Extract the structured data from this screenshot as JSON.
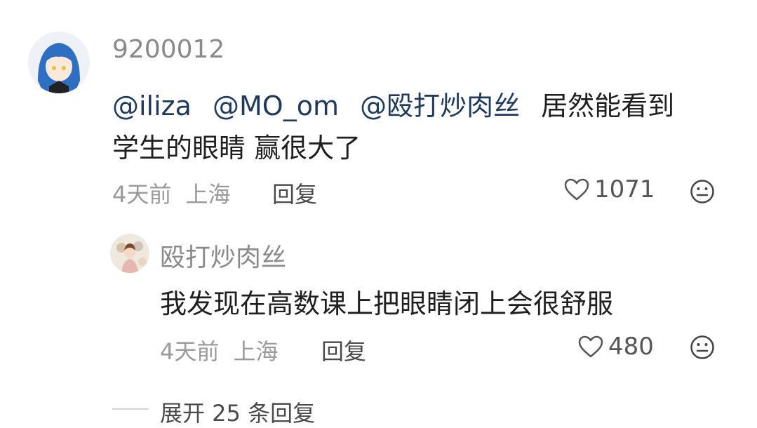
{
  "comment": {
    "username": "9200012",
    "mentions": [
      "@iliza",
      "@MO_om",
      "@殴打炒肉丝"
    ],
    "text_line1_rest": "居然能看到",
    "text_line2": "学生的眼睛 赢很大了",
    "time": "4天前",
    "location": "上海",
    "reply_label": "回复",
    "likes": "1071"
  },
  "reply": {
    "username": "殴打炒肉丝",
    "text": "我发现在高数课上把眼睛闭上会很舒服",
    "time": "4天前",
    "location": "上海",
    "reply_label": "回复",
    "likes": "480"
  },
  "expand": {
    "label": "展开 25 条回复"
  },
  "icons": {
    "like": "heart-outline-icon",
    "emoji": "neutral-face-icon"
  },
  "colors": {
    "mention": "#1f3a5c",
    "meta": "#9a9a9a"
  }
}
